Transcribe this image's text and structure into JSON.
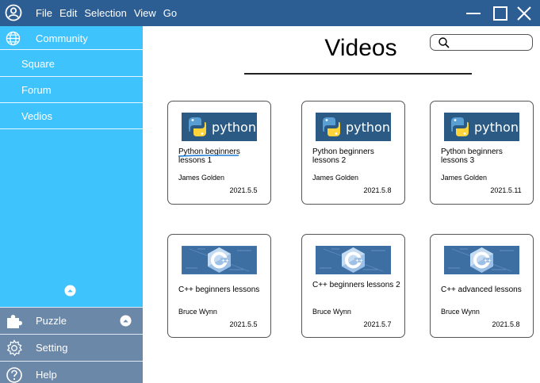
{
  "titlebar": {
    "menu": [
      "File",
      "Edit",
      "Selection",
      "View",
      "Go"
    ]
  },
  "sidebar": {
    "header": {
      "label": "Community",
      "icon": "globe-icon"
    },
    "items": [
      {
        "label": "Square"
      },
      {
        "label": "Forum"
      },
      {
        "label": "Vedios"
      }
    ],
    "bottom": [
      {
        "label": "Puzzle",
        "icon": "puzzle-icon"
      },
      {
        "label": "Setting",
        "icon": "gear-icon"
      },
      {
        "label": "Help",
        "icon": "help-icon"
      }
    ]
  },
  "main": {
    "title": "Videos",
    "search": {
      "placeholder": "",
      "value": ""
    }
  },
  "videos": [
    {
      "title": "Python beginners lessons 1",
      "author": "James Golden",
      "date": "2021.5.5",
      "thumb": "python"
    },
    {
      "title": "Python beginners lessons 2",
      "author": "James Golden",
      "date": "2021.5.8",
      "thumb": "python"
    },
    {
      "title": "Python beginners lessons 3",
      "author": "James Golden",
      "date": "2021.5.11",
      "thumb": "python"
    },
    {
      "title": "C++ beginners lessons",
      "author": "Bruce Wynn",
      "date": "2021.5.5",
      "thumb": "cpp"
    },
    {
      "title": "C++ beginners lessons 2",
      "author": "Bruce Wynn",
      "date": "2021.5.7",
      "thumb": "cpp"
    },
    {
      "title": "C++ advanced lessons",
      "author": "Bruce Wynn",
      "date": "2021.5.8",
      "thumb": "cpp"
    }
  ],
  "thumb_text": {
    "python": "python"
  },
  "colors": {
    "titlebar": "#2d5e93",
    "sidebar": "#3ec3fd",
    "sidebar_bottom": "#6b88a8",
    "python_thumb": "#2b5b84",
    "cpp_thumb": "#3d6fa3",
    "accent_underline": "#1f7ed8"
  }
}
